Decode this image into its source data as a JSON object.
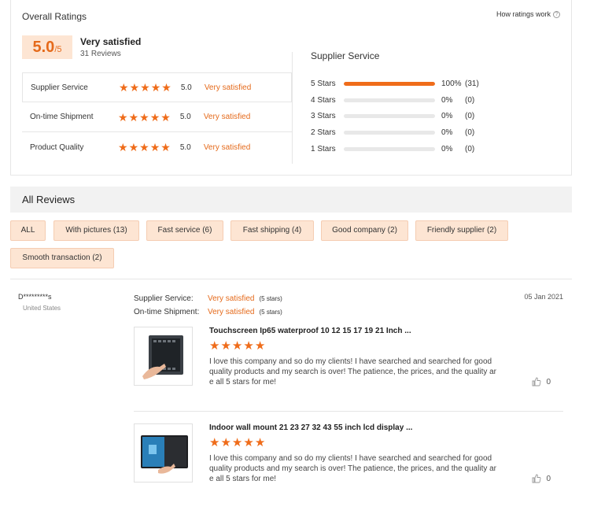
{
  "overall": {
    "title": "Overall Ratings",
    "how_link": "How ratings work",
    "score": "5.0",
    "score_denom": "/5",
    "score_label": "Very satisfied",
    "review_count": "31 Reviews",
    "metrics": [
      {
        "name": "Supplier Service",
        "value": "5.0",
        "label": "Very satisfied"
      },
      {
        "name": "On-time Shipment",
        "value": "5.0",
        "label": "Very satisfied"
      },
      {
        "name": "Product Quality",
        "value": "5.0",
        "label": "Very satisfied"
      }
    ]
  },
  "distribution": {
    "title": "Supplier Service",
    "rows": [
      {
        "label": "5 Stars",
        "fraction": 1.0,
        "pct": "100%",
        "count": "(31)"
      },
      {
        "label": "4 Stars",
        "fraction": 0,
        "pct": "0%",
        "count": "(0)"
      },
      {
        "label": "3 Stars",
        "fraction": 0,
        "pct": "0%",
        "count": "(0)"
      },
      {
        "label": "2 Stars",
        "fraction": 0,
        "pct": "0%",
        "count": "(0)"
      },
      {
        "label": "1 Stars",
        "fraction": 0,
        "pct": "0%",
        "count": "(0)"
      }
    ]
  },
  "all_reviews": {
    "title": "All Reviews",
    "filters": [
      "ALL",
      "With pictures (13)",
      "Fast service (6)",
      "Fast shipping (4)",
      "Good company (2)",
      "Friendly supplier (2)",
      "Smooth transaction (2)"
    ]
  },
  "review": {
    "name": "D*********s",
    "country": "United States",
    "date": "05 Jan 2021",
    "service_rows": [
      {
        "label": "Supplier Service:",
        "value": "Very satisfied",
        "stars": "(5 stars)"
      },
      {
        "label": "On-time Shipment:",
        "value": "Very satisfied",
        "stars": "(5 stars)"
      }
    ],
    "products": [
      {
        "title": "Touchscreen Ip65 waterproof 10 12 15 17 19 21 Inch ...",
        "rating": 5,
        "text": "I love this company and so do my clients! I have searched and searched for good quality products and my search is over! The patience, the prices, and the quality ar e all 5 stars for me!",
        "likes": "0"
      },
      {
        "title": "Indoor wall mount 21 23 27 32 43 55 inch lcd display ...",
        "rating": 5,
        "text": "I love this company and so do my clients! I have searched and searched for good quality products and my search is over! The patience, the prices, and the quality ar e all 5 stars for me!",
        "likes": "0"
      }
    ]
  },
  "colors": {
    "accent": "#ef6c1a",
    "badge_bg": "#fde5d3"
  }
}
